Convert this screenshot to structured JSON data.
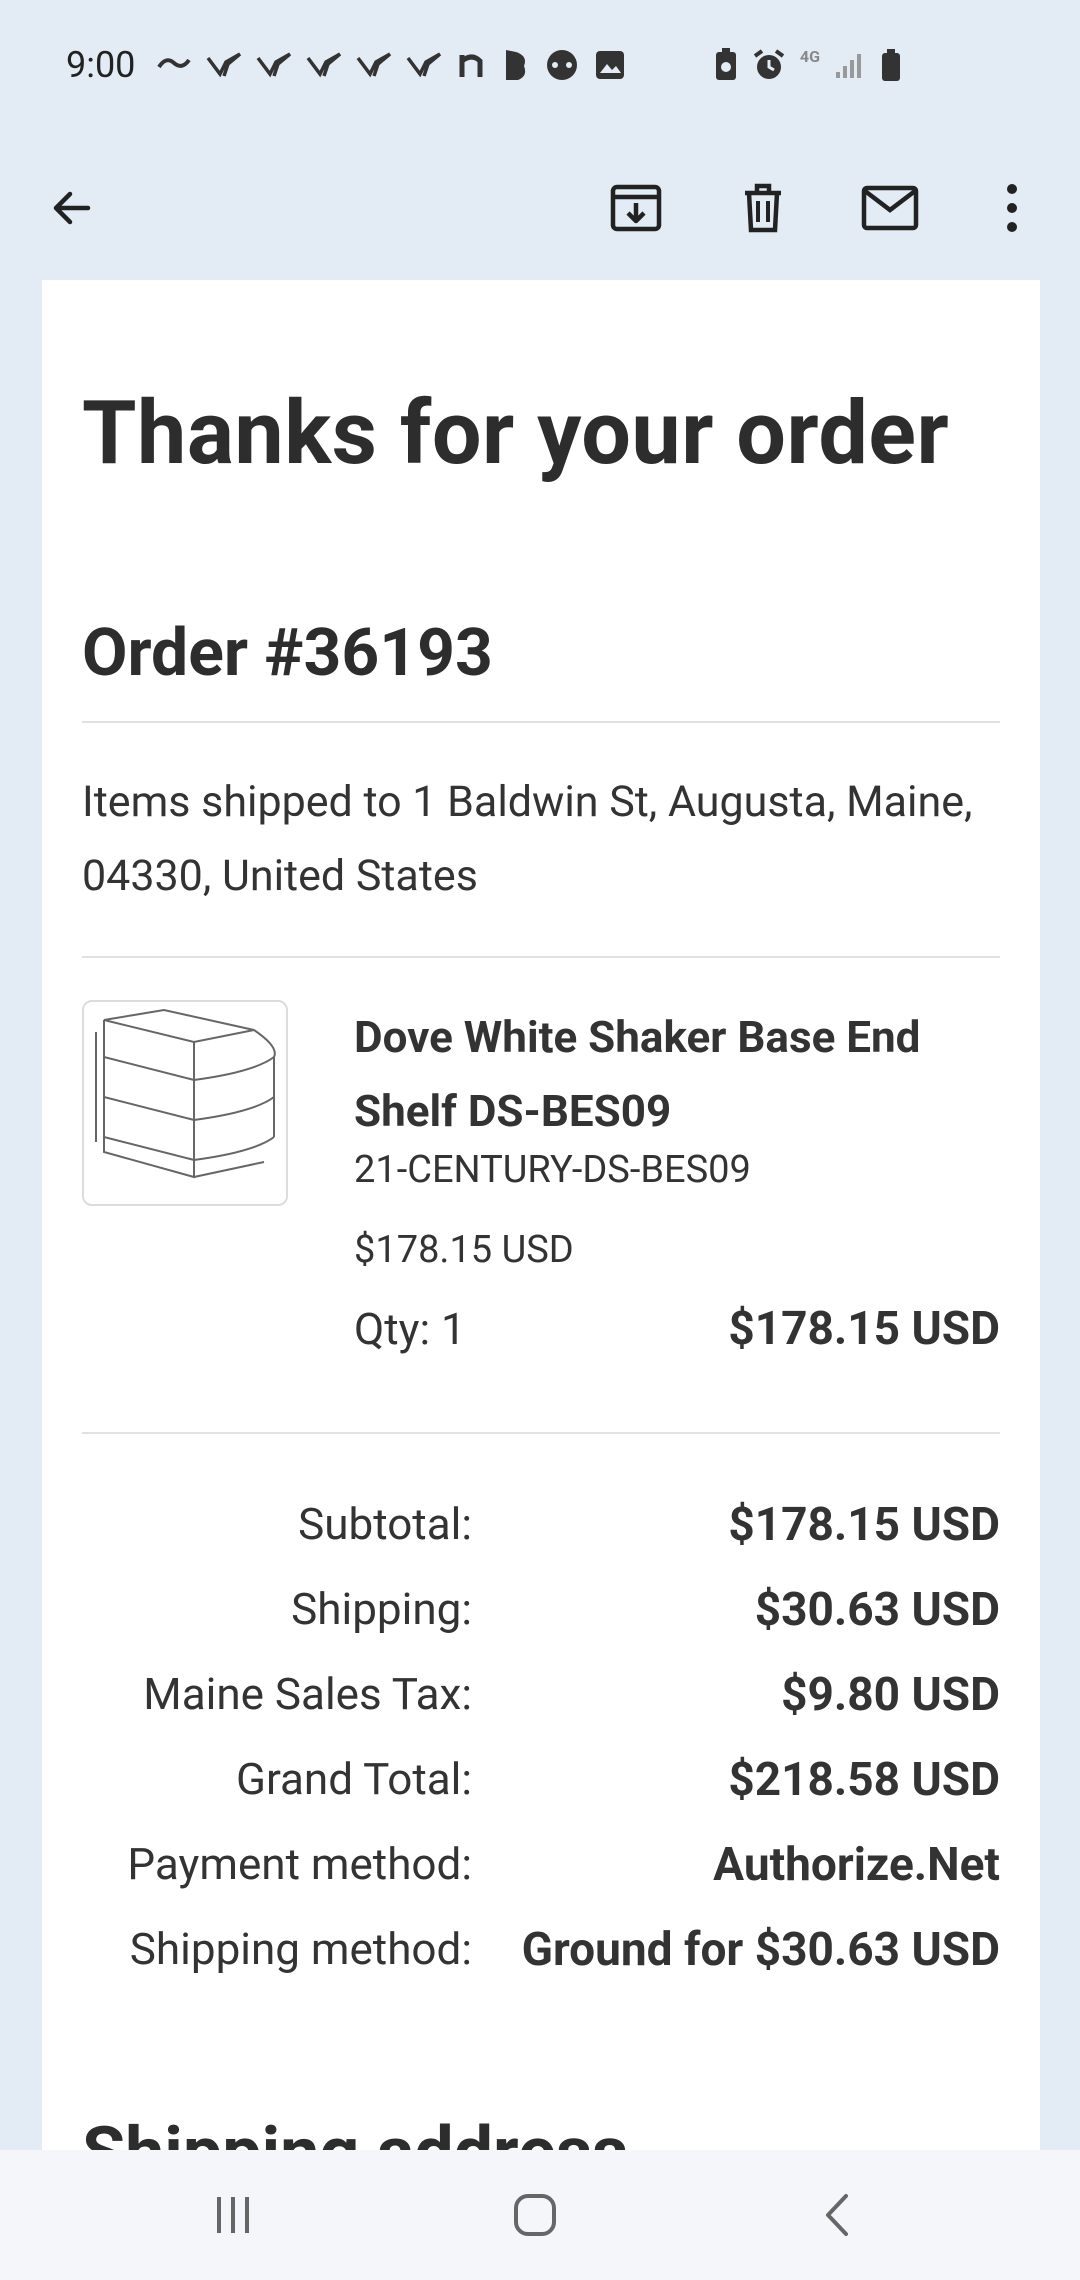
{
  "status_bar": {
    "time": "9:00",
    "notification_icons": [
      "link-icon",
      "bird-icon",
      "bird-icon",
      "bird-icon",
      "bird-icon",
      "bird-icon",
      "n-app-icon",
      "b-app-icon",
      "gamepad-icon",
      "image-icon"
    ],
    "system_icons": [
      "battery-saver-icon",
      "alarm-icon",
      "4g-data-icon",
      "signal-icon",
      "battery-icon"
    ],
    "network_label": "4G"
  },
  "toolbar": {
    "back": "back-arrow-icon",
    "archive": "archive-icon",
    "delete": "trash-icon",
    "mark_unread": "mail-icon",
    "more": "more-vert-icon"
  },
  "email": {
    "title": "Thanks for your order",
    "order_number": "Order #36193",
    "shipped_to": "Items shipped to 1 Baldwin St, Augusta, Maine, 04330, United States",
    "item": {
      "name": "Dove White Shaker Base End Shelf DS-BES09",
      "sku": "21-CENTURY-DS-BES09",
      "unit_price": "$178.15 USD",
      "quantity": "Qty: 1",
      "line_total": "$178.15 USD"
    },
    "summary": [
      {
        "label": "Subtotal:",
        "value": "$178.15 USD"
      },
      {
        "label": "Shipping:",
        "value": "$30.63 USD"
      },
      {
        "label": "Maine Sales Tax:",
        "value": "$9.80 USD"
      },
      {
        "label": "Grand Total:",
        "value": "$218.58 USD"
      },
      {
        "label": "Payment method:",
        "value": "Authorize.Net"
      },
      {
        "label": "Shipping method:",
        "value": "Ground for $30.63 USD"
      }
    ],
    "next_section": "Shipping address"
  },
  "nav_bar": {
    "recents": "recents-icon",
    "home": "home-icon",
    "back": "back-icon"
  }
}
